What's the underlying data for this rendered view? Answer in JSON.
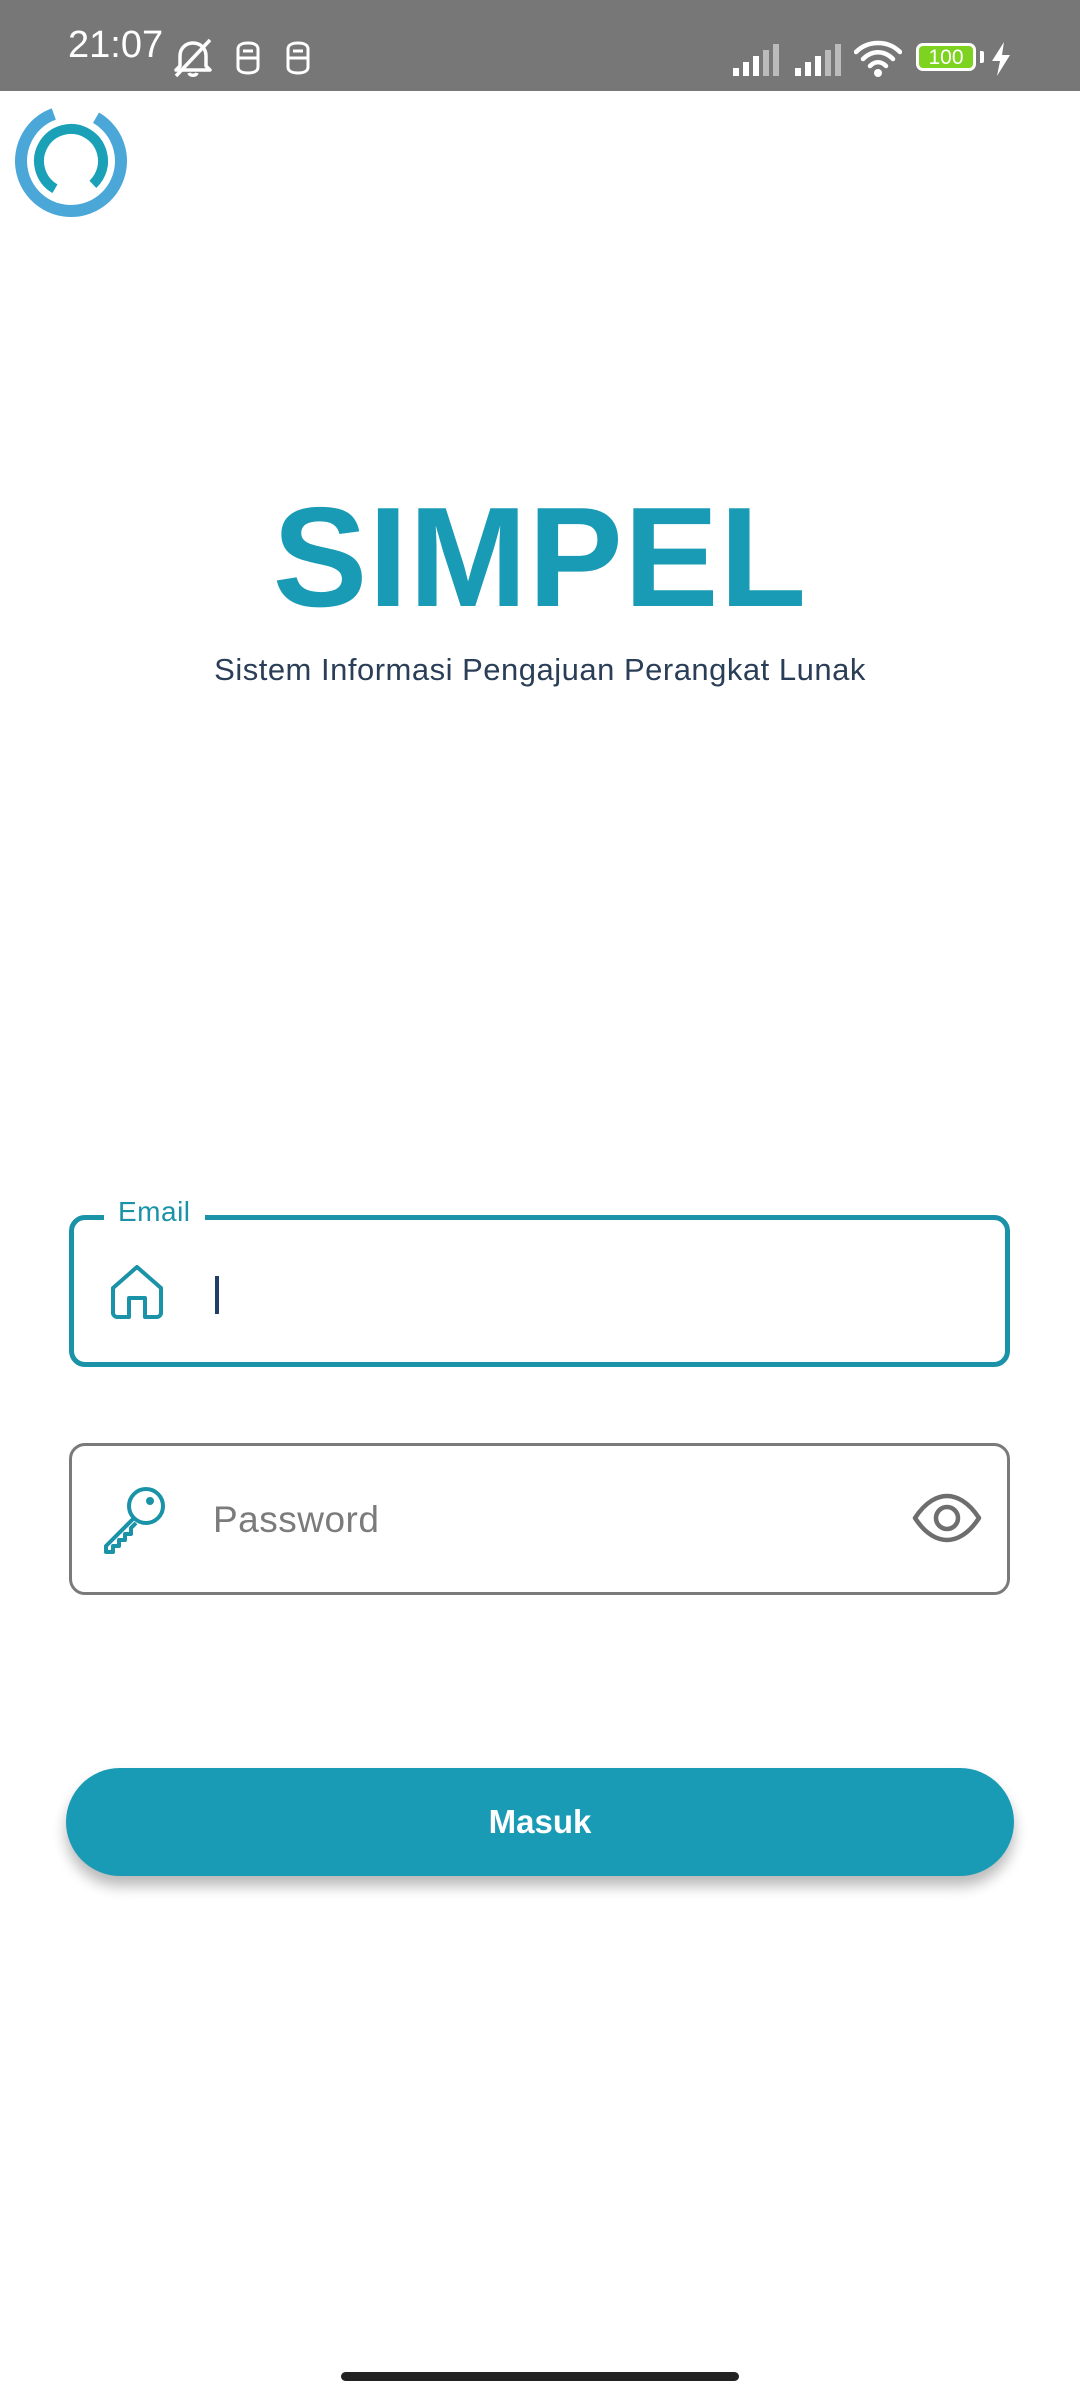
{
  "status_bar": {
    "time": "21:07",
    "battery": "100",
    "icons": [
      "mute-bell-icon",
      "sim-icon",
      "sim-icon",
      "signal-icon",
      "signal-icon",
      "wifi-icon",
      "battery-icon",
      "charging-icon"
    ]
  },
  "app": {
    "title": "SIMPEL",
    "subtitle": "Sistem Informasi Pengajuan Perangkat Lunak",
    "accent_color": "#1a9bb5"
  },
  "form": {
    "email": {
      "label": "Email",
      "value": "",
      "icon": "home-icon"
    },
    "password": {
      "placeholder": "Password",
      "value": "",
      "icon": "key-icon",
      "toggle_icon": "eye-icon"
    },
    "submit_label": "Masuk"
  }
}
